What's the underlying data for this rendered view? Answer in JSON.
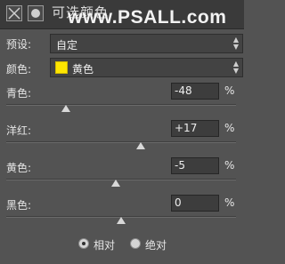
{
  "header": {
    "title": "可选颜色",
    "watermark": "www.PSALL.com"
  },
  "preset": {
    "label": "预设:",
    "value": "自定"
  },
  "colors": {
    "label": "颜色:",
    "value": "黄色",
    "swatch_color": "#ffe600"
  },
  "sliders": [
    {
      "label": "青色:",
      "value": "-48",
      "unit": "%",
      "level": -48
    },
    {
      "label": "洋红:",
      "value": "+17",
      "unit": "%",
      "level": 17
    },
    {
      "label": "黄色:",
      "value": "-5",
      "unit": "%",
      "level": -5
    },
    {
      "label": "黑色:",
      "value": "0",
      "unit": "%",
      "level": 0
    }
  ],
  "method": {
    "options": [
      "相对",
      "绝对"
    ],
    "selected": "相对"
  }
}
